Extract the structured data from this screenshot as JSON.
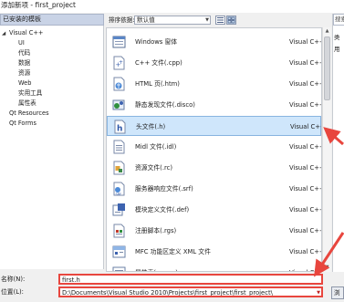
{
  "window": {
    "title": "添加新项 - first_project"
  },
  "sidebar": {
    "header": "已安装的模板",
    "items": [
      {
        "label": "Visual C++",
        "expanded": true,
        "indent": 0
      },
      {
        "label": "UI",
        "indent": 1
      },
      {
        "label": "代码",
        "indent": 1
      },
      {
        "label": "数据",
        "indent": 1
      },
      {
        "label": "资源",
        "indent": 1
      },
      {
        "label": "Web",
        "indent": 1
      },
      {
        "label": "实用工具",
        "indent": 1
      },
      {
        "label": "属性表",
        "indent": 1
      },
      {
        "label": "Qt Resources",
        "indent": 0
      },
      {
        "label": "Qt Forms",
        "indent": 0
      }
    ]
  },
  "toolbar": {
    "sort_label": "排序依据:",
    "sort_value": "默认值"
  },
  "templates": [
    {
      "name": "Windows 窗体",
      "category": "Visual C++",
      "icon": "windows-form-icon"
    },
    {
      "name": "C++ 文件(.cpp)",
      "category": "Visual C++",
      "icon": "cpp-file-icon"
    },
    {
      "name": "HTML 页(.htm)",
      "category": "Visual C++",
      "icon": "html-page-icon"
    },
    {
      "name": "静态发现文件(.disco)",
      "category": "Visual C++",
      "icon": "disco-file-icon"
    },
    {
      "name": "头文件(.h)",
      "category": "Visual C++",
      "icon": "header-file-icon",
      "selected": true
    },
    {
      "name": "Midl 文件(.idl)",
      "category": "Visual C++",
      "icon": "midl-file-icon"
    },
    {
      "name": "资源文件(.rc)",
      "category": "Visual C++",
      "icon": "resource-file-icon"
    },
    {
      "name": "服务器响应文件(.srf)",
      "category": "Visual C++",
      "icon": "srf-file-icon"
    },
    {
      "name": "模块定义文件(.def)",
      "category": "Visual C++",
      "icon": "def-file-icon"
    },
    {
      "name": "注册脚本(.rgs)",
      "category": "Visual C++",
      "icon": "rgs-file-icon"
    },
    {
      "name": "MFC 功能区定义 XML 文件",
      "category": "Visual C++",
      "icon": "mfc-ribbon-xml-icon"
    },
    {
      "name": "属性表(.props)",
      "category": "Visual C++",
      "icon": "props-file-icon"
    }
  ],
  "right_panel": {
    "search_text": "搜索",
    "type_label": "类",
    "desc_label": "用"
  },
  "form": {
    "name_label": "名称(N):",
    "name_value": "first.h",
    "location_label": "位置(L):",
    "location_value": "D:\\Documents\\Visual Studio 2010\\Projects\\first_project\\first_project\\",
    "browse_label": "浏"
  },
  "colors": {
    "annotation_red": "#e8463e",
    "selection_bg": "#cfe6fb",
    "header_bg": "#c9d3e6"
  }
}
